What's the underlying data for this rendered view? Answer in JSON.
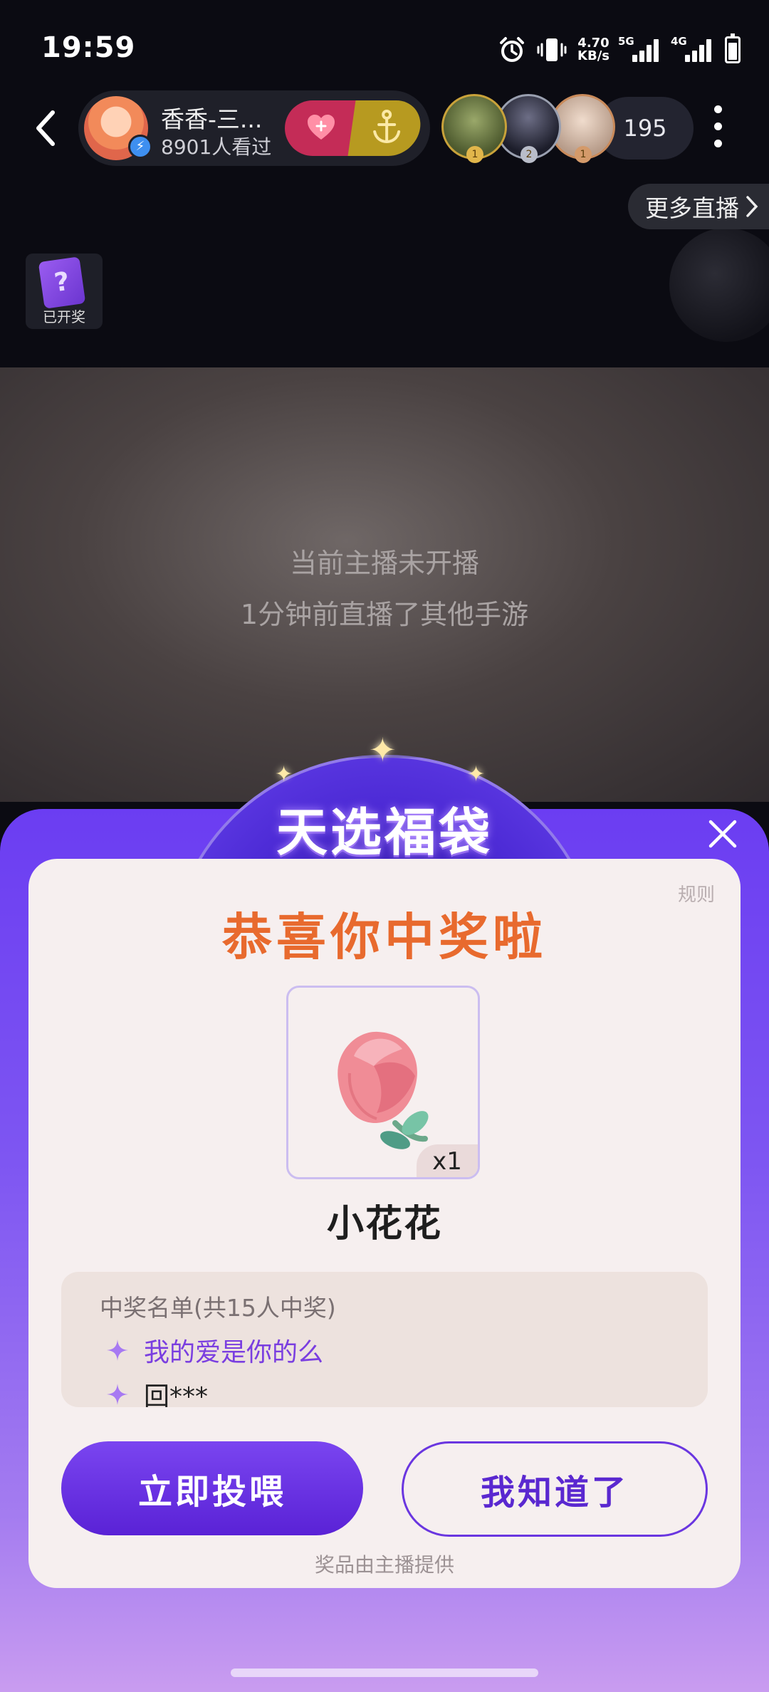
{
  "status_bar": {
    "time": "19:59",
    "net_speed_value": "4.70",
    "net_speed_unit": "KB/s",
    "sim1": "5G",
    "sim2": "4G"
  },
  "header": {
    "anchor_name": "香香-三...",
    "anchor_views": "8901人看过",
    "viewer_count": "195",
    "more_live": "更多直播",
    "lottery_badge": "已开奖",
    "medals": [
      "1",
      "2",
      "1"
    ]
  },
  "stream": {
    "offline_line1": "当前主播未开播",
    "offline_line2": "1分钟前直播了其他手游"
  },
  "popup": {
    "banner_title": "天选福袋",
    "rules": "规则",
    "congrats": "恭喜你中奖啦",
    "prize_qty": "x1",
    "prize_name": "小花花",
    "winners_title": "中奖名单(共15人中奖)",
    "winners": [
      "我的爱是你的么",
      "回***"
    ],
    "feed_button": "立即投喂",
    "ok_button": "我知道了",
    "provided_by": "奖品由主播提供"
  },
  "colors": {
    "accent_purple": "#6a36e0",
    "congrats_orange": "#e86a2e",
    "follow_red": "#c42c57"
  }
}
